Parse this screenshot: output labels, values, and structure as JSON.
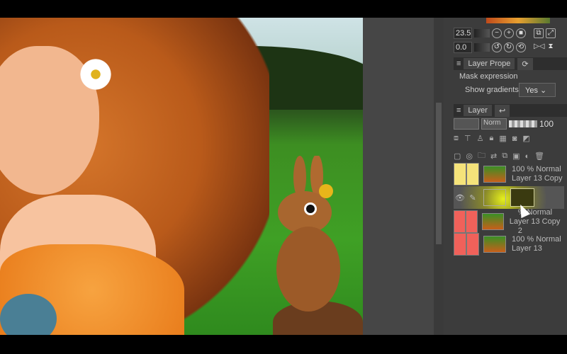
{
  "toolbar": {
    "rotate_value": "23.5",
    "angle_value": "0.0"
  },
  "layer_property": {
    "tab_label": "Layer Prope",
    "section": "Mask expression",
    "show_gradients_label": "Show gradients",
    "show_gradients_value": "Yes"
  },
  "layer_panel": {
    "tab_label": "Layer",
    "blend_mode": "Norm",
    "opacity": "100",
    "layers": [
      {
        "line1": "100 % Normal",
        "line2": "Layer 13 Copy",
        "color": "#f5e37a"
      },
      {
        "line1": "",
        "line2": "",
        "color": "#6b6b4a"
      },
      {
        "line1": "% Normal",
        "line2": "Layer 13 Copy 2",
        "color": "#f0615a"
      },
      {
        "line1": "100 % Normal",
        "line2": "Layer 13",
        "color": "#f0615a"
      }
    ]
  }
}
